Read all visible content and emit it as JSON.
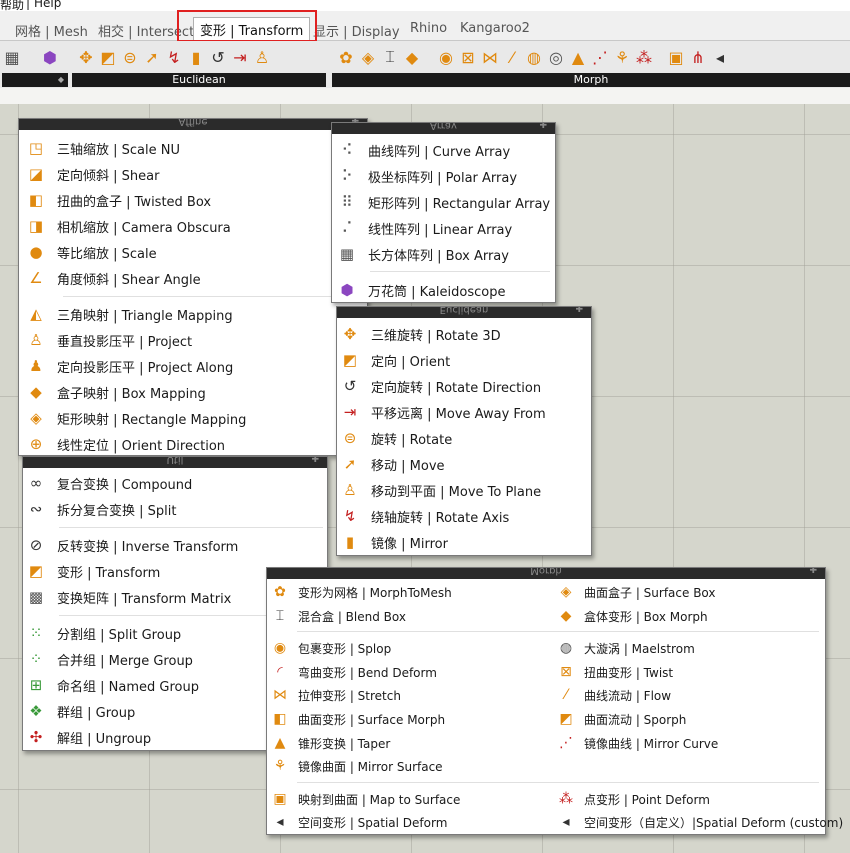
{
  "menubar": {
    "item1": "帮助",
    "item2": "Help"
  },
  "tabs": [
    {
      "label": "网格 | Mesh"
    },
    {
      "label": "相交 | Intersect"
    },
    {
      "label": "变形 | Transform"
    },
    {
      "label": "显示 | Display"
    },
    {
      "label": "Rhino"
    },
    {
      "label": "Kangaroo2"
    }
  ],
  "ribbon": {
    "group_euclidean": "Euclidean",
    "group_morph": "Morph"
  },
  "affine": {
    "title": "Affine",
    "items": [
      {
        "label": "三轴缩放 | Scale NU",
        "icon": "scale-nu-icon"
      },
      {
        "label": "定向倾斜 | Shear",
        "icon": "shear-icon"
      },
      {
        "label": "扭曲的盒子 | Twisted Box",
        "icon": "twisted-box-icon"
      },
      {
        "label": "相机缩放 | Camera Obscura",
        "icon": "camera-obscura-icon"
      },
      {
        "label": "等比缩放 | Scale",
        "icon": "scale-icon"
      },
      {
        "label": "角度倾斜 | Shear Angle",
        "icon": "shear-angle-icon"
      },
      {
        "label": "三角映射 | Triangle Mapping",
        "icon": "triangle-mapping-icon"
      },
      {
        "label": "垂直投影压平 | Project",
        "icon": "project-icon"
      },
      {
        "label": "定向投影压平 | Project Along",
        "icon": "project-along-icon"
      },
      {
        "label": "盒子映射 | Box Mapping",
        "icon": "box-mapping-icon"
      },
      {
        "label": "矩形映射 | Rectangle Mapping",
        "icon": "rectangle-mapping-icon"
      },
      {
        "label": "线性定位 | Orient Direction",
        "icon": "orient-direction-icon"
      }
    ]
  },
  "array": {
    "title": "Array",
    "items": [
      {
        "label": "曲线阵列 | Curve Array",
        "icon": "curve-array-icon"
      },
      {
        "label": "极坐标阵列 | Polar Array",
        "icon": "polar-array-icon"
      },
      {
        "label": "矩形阵列 | Rectangular Array",
        "icon": "rectangular-array-icon"
      },
      {
        "label": "线性阵列 | Linear Array",
        "icon": "linear-array-icon"
      },
      {
        "label": "长方体阵列 | Box Array",
        "icon": "box-array-icon"
      },
      {
        "label": "万花筒 | Kaleidoscope",
        "icon": "kaleidoscope-icon"
      }
    ]
  },
  "euclidean": {
    "title": "Euclidean",
    "items": [
      {
        "label": "三维旋转 | Rotate 3D",
        "icon": "rotate-3d-icon"
      },
      {
        "label": "定向 | Orient",
        "icon": "orient-icon"
      },
      {
        "label": "定向旋转 | Rotate Direction",
        "icon": "rotate-direction-icon"
      },
      {
        "label": "平移远离 | Move Away From",
        "icon": "move-away-icon"
      },
      {
        "label": "旋转 | Rotate",
        "icon": "rotate-icon"
      },
      {
        "label": "移动 | Move",
        "icon": "move-icon"
      },
      {
        "label": "移动到平面 | Move To Plane",
        "icon": "move-to-plane-icon"
      },
      {
        "label": "绕轴旋转 | Rotate Axis",
        "icon": "rotate-axis-icon"
      },
      {
        "label": "镜像 | Mirror",
        "icon": "mirror-icon"
      }
    ]
  },
  "util": {
    "title": "Util",
    "items": [
      {
        "label": "复合变换 | Compound",
        "icon": "compound-icon"
      },
      {
        "label": "拆分复合变换 | Split",
        "icon": "split-icon"
      },
      {
        "label": "反转变换 | Inverse Transform",
        "icon": "inverse-transform-icon"
      },
      {
        "label": "变形 | Transform",
        "icon": "transform-icon"
      },
      {
        "label": "变换矩阵 | Transform Matrix",
        "icon": "transform-matrix-icon"
      },
      {
        "label": "分割组 | Split Group",
        "icon": "split-group-icon"
      },
      {
        "label": "合并组 | Merge Group",
        "icon": "merge-group-icon"
      },
      {
        "label": "命名组 | Named Group",
        "icon": "named-group-icon"
      },
      {
        "label": "群组 | Group",
        "icon": "group-icon"
      },
      {
        "label": "解组 | Ungroup",
        "icon": "ungroup-icon"
      }
    ]
  },
  "morph": {
    "title": "Morph",
    "left": [
      {
        "label": "变形为网格 | MorphToMesh",
        "icon": "morph-to-mesh-icon"
      },
      {
        "label": "混合盒 | Blend Box",
        "icon": "blend-box-icon"
      },
      {
        "label": "包裹变形 | Splop",
        "icon": "splop-icon"
      },
      {
        "label": "弯曲变形 | Bend Deform",
        "icon": "bend-deform-icon"
      },
      {
        "label": "拉伸变形 | Stretch",
        "icon": "stretch-icon"
      },
      {
        "label": "曲面变形 | Surface Morph",
        "icon": "surface-morph-icon"
      },
      {
        "label": "锥形变换 | Taper",
        "icon": "taper-icon"
      },
      {
        "label": "镜像曲面 | Mirror Surface",
        "icon": "mirror-surface-icon"
      },
      {
        "label": "映射到曲面 | Map to Surface",
        "icon": "map-to-surface-icon"
      },
      {
        "label": "空间变形 | Spatial Deform",
        "icon": "spatial-deform-icon"
      }
    ],
    "right": [
      {
        "label": "曲面盒子 | Surface Box",
        "icon": "surface-box-icon"
      },
      {
        "label": "盒体变形 | Box Morph",
        "icon": "box-morph-icon"
      },
      {
        "label": "大漩涡 | Maelstrom",
        "icon": "maelstrom-icon"
      },
      {
        "label": "扭曲变形 | Twist",
        "icon": "twist-icon"
      },
      {
        "label": "曲线流动 | Flow",
        "icon": "flow-icon"
      },
      {
        "label": "曲面流动 | Sporph",
        "icon": "sporph-icon"
      },
      {
        "label": "镜像曲线 | Mirror Curve",
        "icon": "mirror-curve-icon"
      },
      {
        "label": "点变形 | Point Deform",
        "icon": "point-deform-icon"
      },
      {
        "label": "空间变形（自定义）|Spatial Deform (custom)",
        "icon": "spatial-deform-custom-icon"
      }
    ]
  }
}
